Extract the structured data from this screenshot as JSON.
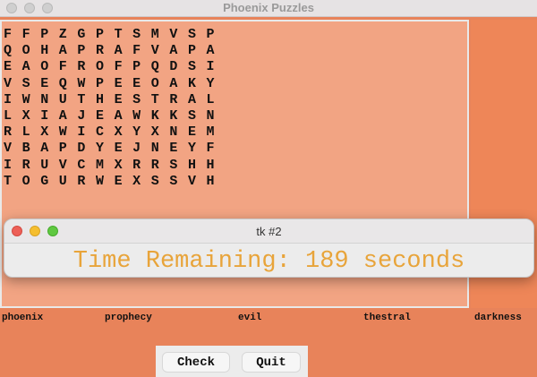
{
  "window": {
    "title": "Phoenix Puzzles"
  },
  "grid": [
    [
      "F",
      "F",
      "P",
      "Z",
      "G",
      "P",
      "T",
      "S",
      "M",
      "V",
      "S",
      "P"
    ],
    [
      "Q",
      "O",
      "H",
      "A",
      "P",
      "R",
      "A",
      "F",
      "V",
      "A",
      "P",
      "A"
    ],
    [
      "E",
      "A",
      "O",
      "F",
      "R",
      "O",
      "F",
      "P",
      "Q",
      "D",
      "S",
      "I"
    ],
    [
      "V",
      "S",
      "E",
      "Q",
      "W",
      "P",
      "E",
      "E",
      "O",
      "A",
      "K",
      "Y"
    ],
    [
      "I",
      "W",
      "N",
      "U",
      "T",
      "H",
      "E",
      "S",
      "T",
      "R",
      "A",
      "L"
    ],
    [
      "L",
      "X",
      "I",
      "A",
      "J",
      "E",
      "A",
      "W",
      "K",
      "K",
      "S",
      "N"
    ],
    [
      "R",
      "L",
      "X",
      "W",
      "I",
      "C",
      "X",
      "Y",
      "X",
      "N",
      "E",
      "M"
    ],
    [
      "V",
      "B",
      "A",
      "P",
      "D",
      "Y",
      "E",
      "J",
      "N",
      "E",
      "Y",
      "F"
    ],
    [
      "I",
      "R",
      "U",
      "V",
      "C",
      "M",
      "X",
      "R",
      "R",
      "S",
      "H",
      "H"
    ],
    [
      "T",
      "O",
      "G",
      "U",
      "R",
      "W",
      "E",
      "X",
      "S",
      "S",
      "V",
      "H"
    ]
  ],
  "words": [
    "phoenix",
    "prophecy",
    "evil",
    "thestral",
    "darkness"
  ],
  "buttons": {
    "check": "Check",
    "quit": "Quit"
  },
  "dialog": {
    "title": "tk #2",
    "timer_text": "Time Remaining: 189 seconds"
  },
  "colors": {
    "background": "#e8835a",
    "canvas": "#f2a483",
    "timer": "#e8a43a"
  }
}
